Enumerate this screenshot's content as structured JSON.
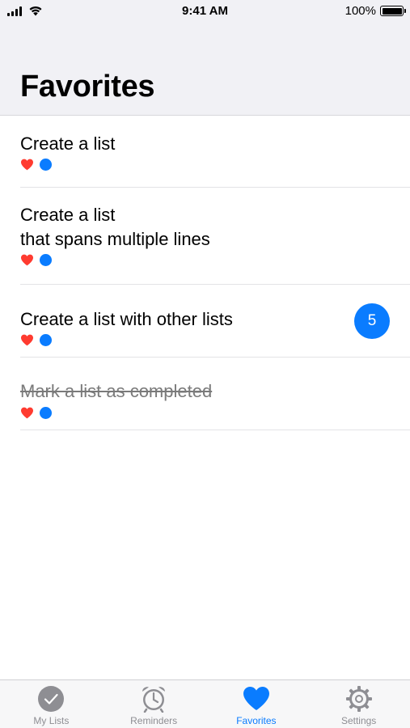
{
  "status_bar": {
    "time": "9:41 AM",
    "battery": "100%",
    "icons": [
      "signal-icon",
      "wifi-icon",
      "battery-icon"
    ]
  },
  "header": {
    "title": "Favorites"
  },
  "list": {
    "items": [
      {
        "title": "Create a list",
        "tags": [
          "heart",
          "blue-dot"
        ]
      },
      {
        "title": "Create a list\nthat spans multiple lines",
        "tags": [
          "heart",
          "blue-dot"
        ]
      },
      {
        "title": "Create a list with other lists",
        "tags": [
          "heart",
          "blue-dot"
        ],
        "badge": "5"
      },
      {
        "title": "Mark a list as completed",
        "tags": [
          "heart",
          "blue-dot"
        ],
        "completed": true
      }
    ]
  },
  "tab_bar": {
    "tabs": [
      {
        "label": "My Lists",
        "icon": "checkmark-circle-icon",
        "active": false
      },
      {
        "label": "Reminders",
        "icon": "alarm-clock-icon",
        "active": false
      },
      {
        "label": "Favorites",
        "icon": "heart-icon",
        "active": true
      },
      {
        "label": "Settings",
        "icon": "gear-icon",
        "active": false
      }
    ]
  },
  "colors": {
    "accent": "#0a7cff",
    "heart": "#ff3b30",
    "inactive": "#8e8e93",
    "header_bg": "#f1f1f5"
  }
}
